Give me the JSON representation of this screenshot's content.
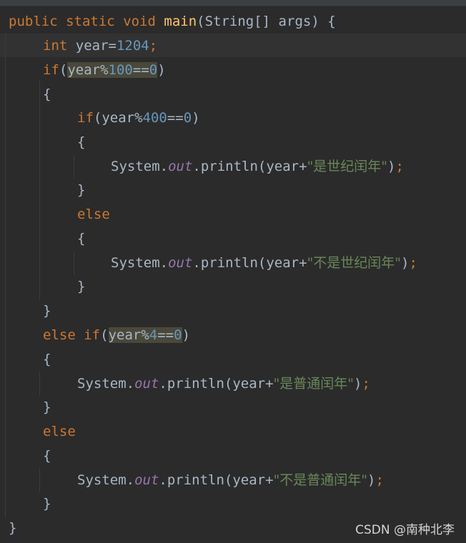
{
  "editor": {
    "code": {
      "l1": {
        "mod1": "public",
        "mod2": "static",
        "type": "void",
        "name": "main",
        "params": "(String[] args) {"
      },
      "l2": {
        "type": "int",
        "expr": "year=",
        "num": "1204",
        "semi": ";"
      },
      "l3": {
        "kw": "if",
        "open": "(",
        "cond": "year%",
        "num": "100",
        "eq": "==",
        "zero": "0",
        "close": ")"
      },
      "l4": {
        "text": "{"
      },
      "l5": {
        "kw": "if",
        "open": "(year%",
        "num": "400",
        "eq": "==",
        "zero": "0",
        "close": ")"
      },
      "l6": {
        "text": "{"
      },
      "l7": {
        "obj": "System.",
        "field": "out",
        "call": ".println(year+",
        "str": "\"是世纪闰年\"",
        "close": ")",
        "semi": ";"
      },
      "l8": {
        "text": "}"
      },
      "l9": {
        "kw": "else"
      },
      "l10": {
        "text": "{"
      },
      "l11": {
        "obj": "System.",
        "field": "out",
        "call": ".println(year+",
        "str": "\"不是世纪闰年\"",
        "close": ")",
        "semi": ";"
      },
      "l12": {
        "text": "}"
      },
      "l13": {
        "text": "}"
      },
      "l14": {
        "kw1": "else",
        "kw2": "if",
        "open": "(",
        "cond": "year%",
        "num": "4",
        "eq": "==",
        "zero": "0",
        "close": ")"
      },
      "l15": {
        "text": "{"
      },
      "l16": {
        "obj": "System.",
        "field": "out",
        "call": ".println(year+",
        "str": "\"是普通闰年\"",
        "close": ")",
        "semi": ";"
      },
      "l17": {
        "text": "}"
      },
      "l18": {
        "kw": "else"
      },
      "l19": {
        "text": "{"
      },
      "l20": {
        "obj": "System.",
        "field": "out",
        "call": ".println(year+",
        "str": "\"不是普通闰年\"",
        "close": ")",
        "semi": ";"
      },
      "l21": {
        "text": "}"
      },
      "l22": {
        "text": "}"
      }
    }
  },
  "watermark": "CSDN @南种北李",
  "colors": {
    "background": "#2b2b2b",
    "keyword": "#cc7832",
    "method": "#ffc66d",
    "number": "#6897bb",
    "field": "#9876aa",
    "string": "#6a8759",
    "text": "#a9b7c6",
    "highlight": "#49483a"
  }
}
